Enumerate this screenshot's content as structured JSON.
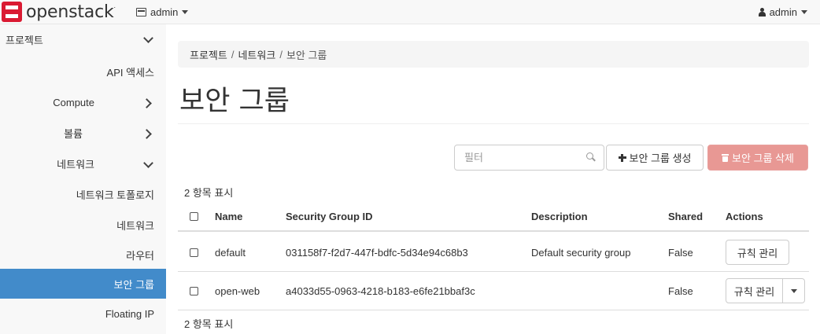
{
  "navbar": {
    "brand": "openstack",
    "brand_mark": ".",
    "project_label": "admin",
    "user_label": "admin"
  },
  "sidebar": {
    "items": [
      {
        "label": "프로젝트",
        "chevron": "down"
      },
      {
        "label": "API 액세스"
      },
      {
        "label": "Compute",
        "chevron": "right"
      },
      {
        "label": "볼륨",
        "chevron": "right"
      },
      {
        "label": "네트워크",
        "chevron": "down"
      },
      {
        "label": "네트워크 토폴로지"
      },
      {
        "label": "네트워크"
      },
      {
        "label": "라우터"
      },
      {
        "label": "보안 그룹",
        "active": true
      },
      {
        "label": "Floating IP"
      }
    ]
  },
  "breadcrumb": {
    "items": [
      "프로젝트",
      "네트워크",
      "보안 그룹"
    ],
    "separator": "/"
  },
  "page": {
    "title": "보안 그룹"
  },
  "toolbar": {
    "filter_placeholder": "필터",
    "filter_value": "",
    "create_label": "보안 그룹 생성",
    "delete_label": "보안 그룹 삭제"
  },
  "table": {
    "count_top": "2 항목 표시",
    "count_bottom": "2 항목 표시",
    "columns": [
      "Name",
      "Security Group ID",
      "Description",
      "Shared",
      "Actions"
    ],
    "rows": [
      {
        "name": "default",
        "id": "031158f7-f2d7-447f-bdfc-5d34e94c68b3",
        "description": "Default security group",
        "shared": "False",
        "action": "규칙 관리"
      },
      {
        "name": "open-web",
        "id": "a4033d55-0963-4218-b183-e6fe21bbaf3c",
        "description": "",
        "shared": "False",
        "action": "규칙 관리"
      }
    ]
  },
  "colors": {
    "active": "#428bca",
    "danger": "#e89894",
    "brand": "#da1a32"
  }
}
